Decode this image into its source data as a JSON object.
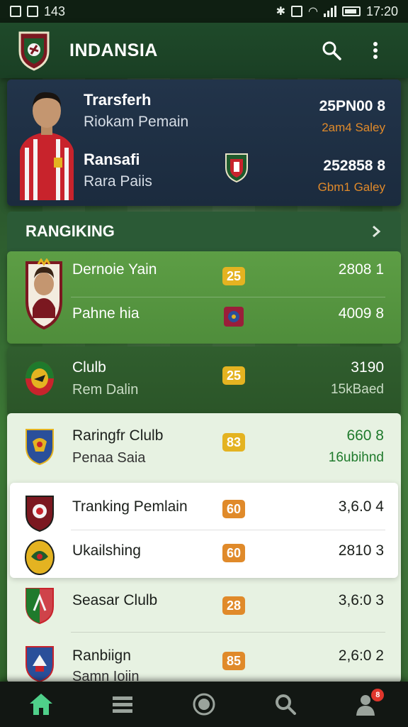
{
  "status_bar": {
    "time_left": "143",
    "time_right": "17:20"
  },
  "app_bar": {
    "title": "INDANSIA",
    "icons": [
      "search-icon",
      "more-vert-icon"
    ]
  },
  "transfer_card": {
    "rows": [
      {
        "title": "Trarsferh",
        "subtitle": "Riokam Pemain",
        "value": "25PN00 8",
        "salary": "2am4 Saley"
      },
      {
        "title": "Ransafi",
        "subtitle": "Rara Paiis",
        "value": "252858 8",
        "salary": "Gbm1 Galey"
      }
    ]
  },
  "ranking": {
    "title": "RANGIKING",
    "group1": [
      {
        "name": "Dernoie Yain",
        "badge": "25",
        "value": "2808 1"
      },
      {
        "name": "Pahne hia",
        "value": "4009 8"
      }
    ],
    "group2": [
      {
        "name": "Clulb",
        "subtitle": "Rem Dalin",
        "badge": "25",
        "value": "3190",
        "value2": "15kBaed"
      }
    ],
    "group3": [
      {
        "name": "Raringfr Clulb",
        "subtitle": "Penaa Saia",
        "badge": "83",
        "value": "660 8",
        "value2": "16ubihnd"
      },
      {
        "name": "Tranking Pemlain",
        "badge": "60",
        "value": "3,6.0 4"
      },
      {
        "name": "Ukailshing",
        "badge": "60",
        "value": "2810 3"
      },
      {
        "name": "Seasar Clulb",
        "badge": "28",
        "value": "3,6:0 3"
      },
      {
        "name": "Ranbiign",
        "subtitle": "Samn Ioiin",
        "badge": "85",
        "value": "2,6:0 2"
      }
    ]
  },
  "bottom_nav": {
    "items": [
      "home-icon",
      "list-icon",
      "circle-icon",
      "search-icon",
      "profile-icon"
    ],
    "notification_count": "8"
  },
  "colors": {
    "accent_green": "#4f8d3b",
    "orange": "#e08a2a",
    "yellow": "#e4b321"
  }
}
